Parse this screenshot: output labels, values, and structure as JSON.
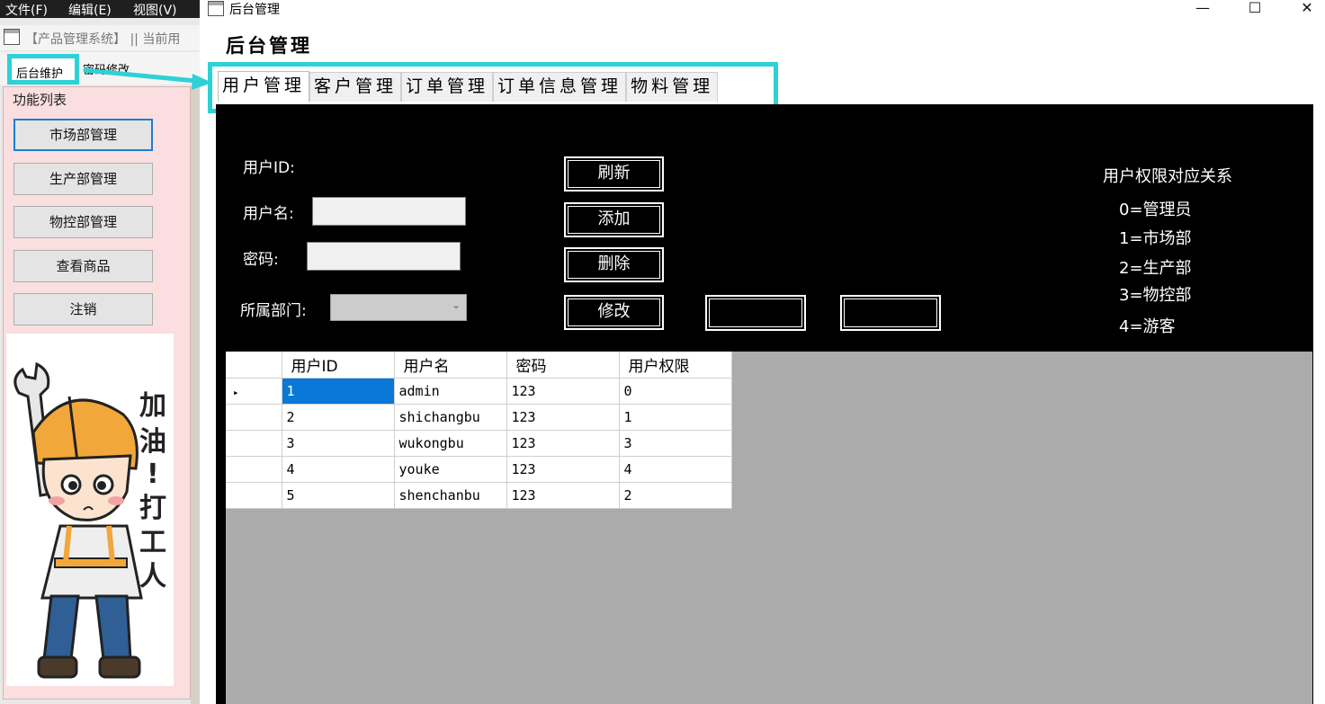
{
  "left_app": {
    "menu": [
      "文件(F)",
      "编辑(E)",
      "视图(V)"
    ],
    "subtitle": "【产品管理系统】 || 当前用",
    "tabs": [
      "后台维护",
      "密码修改"
    ],
    "function_list_title": "功能列表",
    "buttons": [
      "市场部管理",
      "生产部管理",
      "物控部管理",
      "查看商品",
      "注销"
    ],
    "mascot_text": "加油!打工人"
  },
  "window": {
    "title": "后台管理",
    "controls": {
      "minimize": "—",
      "maximize": "☐",
      "close": "✕"
    }
  },
  "heading": "后台管理",
  "tabs": [
    "用户管理",
    "客户管理",
    "订单管理",
    "订单信息管理",
    "物料管理"
  ],
  "form": {
    "user_id_label": "用户ID:",
    "username_label": "用户名:",
    "password_label": "密码:",
    "dept_label": "所属部门:",
    "username_value": "",
    "password_value": "",
    "dept_value": ""
  },
  "actions": {
    "refresh": "刷新",
    "add": "添加",
    "delete": "删除",
    "modify": "修改"
  },
  "permissions": {
    "title": "用户权限对应关系",
    "items": [
      "0=管理员",
      "1=市场部",
      "2=生产部",
      "3=物控部",
      "4=游客"
    ]
  },
  "table": {
    "columns": [
      "用户ID",
      "用户名",
      "密码",
      "用户权限"
    ],
    "rows": [
      [
        "1",
        "admin",
        "123",
        "0"
      ],
      [
        "2",
        "shichangbu",
        "123",
        "1"
      ],
      [
        "3",
        "wukongbu",
        "123",
        "3"
      ],
      [
        "4",
        "youke",
        "123",
        "4"
      ],
      [
        "5",
        "shenchanbu",
        "123",
        "2"
      ]
    ],
    "current_row_marker": "▸"
  },
  "colors": {
    "highlight": "#2ed1d6",
    "selection": "#0a78d7",
    "panel_pink": "#fbdfe0"
  }
}
